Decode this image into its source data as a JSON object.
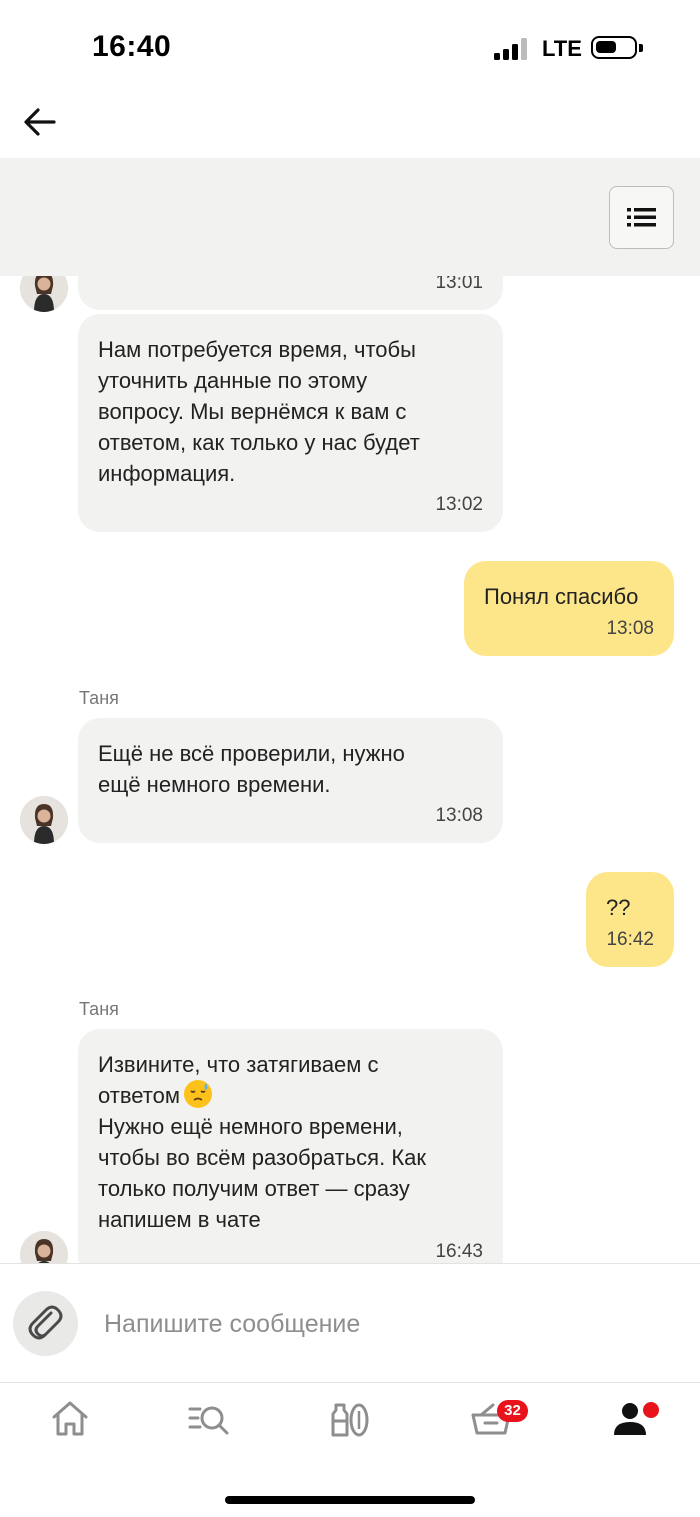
{
  "status_bar": {
    "time": "16:40",
    "network": "LTE",
    "signal_icon": "signal-bars-icon",
    "battery_icon": "battery-icon"
  },
  "header": {
    "back_icon": "arrow-left-icon",
    "menu_icon": "list-menu-icon"
  },
  "messages": [
    {
      "direction": "incoming",
      "text": "",
      "time": "13:01"
    },
    {
      "direction": "incoming",
      "text": "Нам потребуется время, чтобы\nуточнить данные по этому\nвопросу. Мы вернёмся к вам с\nответом, как только у нас будет\nинформация.",
      "time": "13:02"
    },
    {
      "direction": "outgoing",
      "text": "Понял спасибо",
      "time": "13:08"
    },
    {
      "direction": "incoming",
      "sender": "Таня",
      "text": "Ещё не всё проверили, нужно\nещё немного времени.",
      "time": "13:08"
    },
    {
      "direction": "outgoing",
      "text": "??",
      "time": "16:42"
    },
    {
      "direction": "incoming",
      "sender": "Таня",
      "text_before_emoji": "Извините, что затягиваем с\nответом",
      "emoji": "downcast-face-with-sweat-emoji",
      "text_after_emoji": "Нужно ещё немного времени,\nчтобы во всём разобраться. Как\nтолько получим ответ — сразу\nнапишем в чате",
      "time": "16:43"
    }
  ],
  "composer": {
    "placeholder": "Напишите сообщение",
    "value": "",
    "attach_icon": "paperclip-icon"
  },
  "tab_bar": {
    "items": [
      {
        "icon": "home-icon"
      },
      {
        "icon": "catalog-search-icon"
      },
      {
        "icon": "products-icon"
      },
      {
        "icon": "cart-icon",
        "badge": "32"
      },
      {
        "icon": "profile-icon",
        "dot": true
      }
    ]
  },
  "colors": {
    "outgoing_bubble": "#fde68a",
    "incoming_bubble": "#f2f2f0",
    "badge": "#e8131b",
    "header_bg": "#f2f2f0"
  }
}
